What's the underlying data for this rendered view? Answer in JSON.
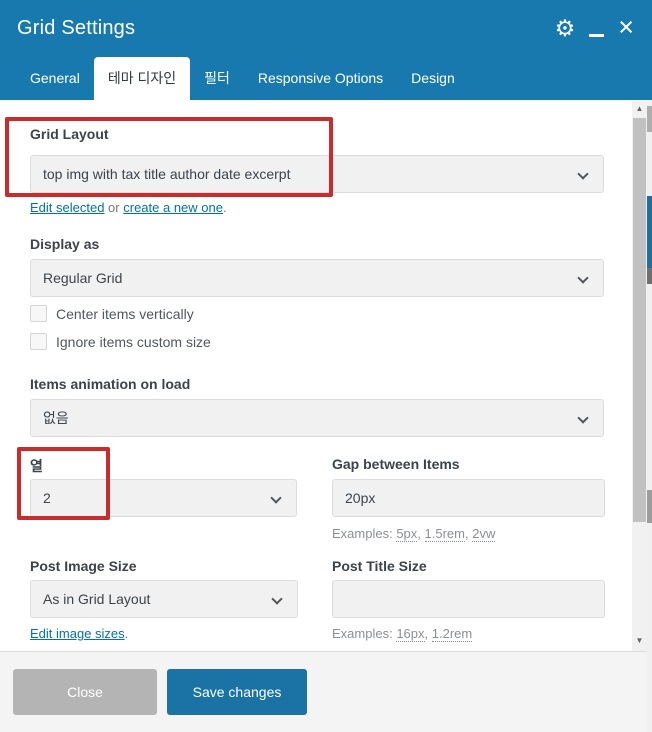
{
  "window": {
    "title": "Grid Settings",
    "icons": {
      "settings": "⚙",
      "close": "×",
      "minimize": "_"
    }
  },
  "tabs": [
    {
      "label": "General",
      "active": false
    },
    {
      "label": "테마 디자인",
      "active": true
    },
    {
      "label": "필터",
      "active": false
    },
    {
      "label": "Responsive Options",
      "active": false
    },
    {
      "label": "Design",
      "active": false
    }
  ],
  "fields": {
    "grid_layout": {
      "label": "Grid Layout",
      "value": "top img with tax title author date excerpt"
    },
    "grid_layout_links": {
      "edit": "Edit selected",
      "or": " or ",
      "create": "create a new one",
      "period": "."
    },
    "display_as": {
      "label": "Display as",
      "value": "Regular Grid"
    },
    "center_items": {
      "label": "Center items vertically",
      "checked": false
    },
    "ignore_size": {
      "label": "Ignore items custom size",
      "checked": false
    },
    "animation": {
      "label": "Items animation on load",
      "value": "없음"
    },
    "columns": {
      "label": "열",
      "value": "2"
    },
    "gap": {
      "label": "Gap between Items",
      "value": "20px",
      "hint_label": "Examples: ",
      "sep": ", ",
      "examples": [
        "5px",
        "1.5rem",
        "2vw"
      ]
    },
    "post_image_size": {
      "label": "Post Image Size",
      "value": "As in Grid Layout",
      "edit_link": "Edit image sizes",
      "period": "."
    },
    "post_title_size": {
      "label": "Post Title Size",
      "value": "",
      "hint_label": "Examples: ",
      "sep": ", ",
      "examples": [
        "16px",
        "1.2rem"
      ]
    }
  },
  "footer": {
    "close": "Close",
    "save": "Save changes"
  },
  "colors": {
    "titlebar": "#1879ae",
    "link": "#0073aa",
    "annotation": "#cc2b2b",
    "save_button": "#1a72a5",
    "close_button": "#b4b4b4",
    "input_bg": "#f1f1f1",
    "label_text": "#3c434a"
  }
}
